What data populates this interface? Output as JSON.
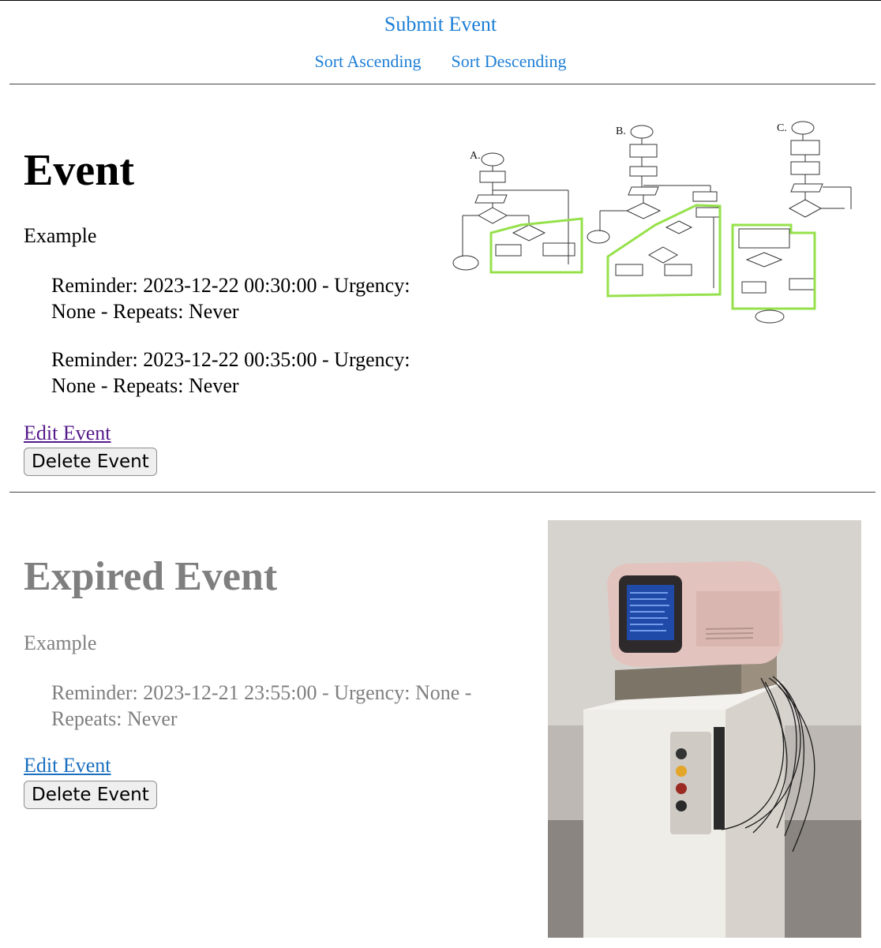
{
  "nav": {
    "submit": "Submit Event",
    "sort_asc": "Sort Ascending",
    "sort_desc": "Sort Descending"
  },
  "events": [
    {
      "title": "Event",
      "description": "Example",
      "reminders": [
        "Reminder: 2023-12-22 00:30:00 - Urgency: None - Repeats: Never",
        "Reminder: 2023-12-22 00:35:00 - Urgency: None - Repeats: Never"
      ],
      "edit_label": "Edit Event",
      "delete_label": "Delete Event",
      "image_labels": {
        "a": "A.",
        "b": "B.",
        "c": "C."
      }
    },
    {
      "title": "Expired Event",
      "description": "Example",
      "reminders": [
        "Reminder: 2023-12-21 23:55:00 - Urgency: None - Repeats: Never"
      ],
      "edit_label": "Edit Event",
      "delete_label": "Delete Event"
    }
  ]
}
